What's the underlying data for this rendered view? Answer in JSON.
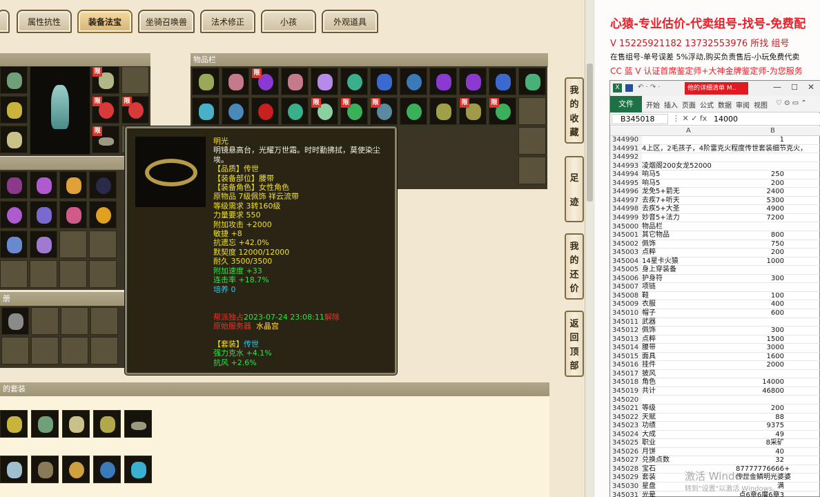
{
  "tabs": [
    "属性抗性",
    "装备法宝",
    "坐骑召唤兽",
    "法术修正",
    "小孩",
    "外观道具"
  ],
  "active_tab": "装备法宝",
  "inventory": {
    "header": "物品栏"
  },
  "lock_badge": "限",
  "set_panel": {
    "header_fragment": "的套装"
  },
  "book_panel": {
    "header_fragment": "册"
  },
  "side_buttons": [
    {
      "label": [
        "我",
        "的",
        "收",
        "藏"
      ]
    },
    {
      "label": [
        "足",
        "迹"
      ]
    },
    {
      "label": [
        "我",
        "的",
        "还",
        "价"
      ]
    },
    {
      "label": [
        "返",
        "回",
        "顶",
        "部"
      ]
    }
  ],
  "tooltip": {
    "name": "明光",
    "desc": "明镜悬高台，光耀万世霜。时时勤拂拭，莫使染尘埃。",
    "quality_label": "【品质】",
    "quality": "传世",
    "slot_label": "【装备部位】",
    "slot": "腰带",
    "role_label": "【装备角色】",
    "role": "女性角色",
    "origin": "原物品 7级佩饰 祥云流带",
    "level_req": "等级需求 3转160级",
    "str_req": "力量要求 550",
    "attack": "附加攻击 +2000",
    "agility": "敏捷 +8",
    "resist_forget": "抗遗忘 +42.0%",
    "tacit": "默契度 12000/12000",
    "durability": "耐久 3500/3500",
    "speed": "附加速度 +33",
    "combo": "连击率 +18.7%",
    "cultivate": "培养 0",
    "bind_time": "2023-07-24 23:08:11",
    "bind_prefix": "帮派独占",
    "bind_suffix": "解除",
    "server_prefix": "原始服务器",
    "server": "水晶宫",
    "set_label": "【套装】",
    "set": "传世",
    "set_bonus1": "强力克水 +4.1%",
    "set_bonus2": "抗风 +2.6%"
  },
  "overlay": {
    "headline": "心猿-专业估价-代卖组号-找号-免费配",
    "contact": "V 15225921182  13732553976 所找 组号",
    "notice": "在售组号-单号误差 5%浮动,购买负责售后-小玩免费代卖",
    "promo": "CC 蓝 V 认证首席鉴定师+大神金牌鉴定师-为您服务"
  },
  "excel": {
    "title_tab": "他的详细清单 M..",
    "ribbon": [
      "文件",
      "开始",
      "插入",
      "页面",
      "公式",
      "数据",
      "审阅",
      "视图"
    ],
    "name_box": "B345018",
    "formula": "14000",
    "col_a": "A",
    "col_b": "B",
    "rows": [
      [
        "344990",
        "",
        "1"
      ],
      [
        "344991",
        "4上区，2毛孩子，4阶雷克火程度传世套装细节克火，",
        ""
      ],
      [
        "344992",
        "",
        ""
      ],
      [
        "344993",
        "凌烟阁200女龙52000",
        ""
      ],
      [
        "344994",
        "响马5",
        "250"
      ],
      [
        "344995",
        "响马5",
        "200"
      ],
      [
        "344996",
        "龙免5+箭无",
        "2400"
      ],
      [
        "344997",
        "去疾7+听天",
        "5300"
      ],
      [
        "344998",
        "去疾5+大圣",
        "4900"
      ],
      [
        "344999",
        "妙音5+法力",
        "7200"
      ],
      [
        "345000",
        "物品栏",
        ""
      ],
      [
        "345001",
        "其它物品",
        "800"
      ],
      [
        "345002",
        "佩饰",
        "750"
      ],
      [
        "345003",
        "点粹",
        "200"
      ],
      [
        "345004",
        "14星卡火猿",
        "1000"
      ],
      [
        "345005",
        "身上穿装备",
        ""
      ],
      [
        "345006",
        "护身符",
        "300"
      ],
      [
        "345007",
        "项链",
        ""
      ],
      [
        "345008",
        "鞋",
        "100"
      ],
      [
        "345009",
        "衣服",
        "400"
      ],
      [
        "345010",
        "帽子",
        "600"
      ],
      [
        "345011",
        "武器",
        ""
      ],
      [
        "345012",
        "佩饰",
        "300"
      ],
      [
        "345013",
        "点粹",
        "1500"
      ],
      [
        "345014",
        "腰带",
        "3000"
      ],
      [
        "345015",
        "面具",
        "1600"
      ],
      [
        "345016",
        "挂件",
        "2000"
      ],
      [
        "345017",
        "披风",
        ""
      ],
      [
        "345018",
        "角色",
        "14000"
      ],
      [
        "345019",
        "共计",
        "46800"
      ],
      [
        "345020",
        "",
        ""
      ],
      [
        "345021",
        "等级",
        "200"
      ],
      [
        "345022",
        "天赋",
        "88"
      ],
      [
        "345023",
        "功绩",
        "9375"
      ],
      [
        "345024",
        "大成",
        "49"
      ],
      [
        "345025",
        "职业",
        "8采矿"
      ],
      [
        "345026",
        "月饼",
        "40"
      ],
      [
        "345027",
        "兑换点数",
        "32"
      ],
      [
        "345028",
        "宝石",
        "87777776666+"
      ],
      [
        "345029",
        "套装",
        "传世金鳞明光婆婆"
      ],
      [
        "345030",
        "星盘",
        "满"
      ],
      [
        "345031",
        "光晕",
        "点6章6魔6章3"
      ]
    ],
    "watermark1": "激活 Windows",
    "watermark2": "转到\"设置\"以激活 Windows。"
  },
  "colors": {
    "lock": "#d9362e",
    "tooltip_bg": "#2a2415",
    "headline": "#e8202a"
  }
}
